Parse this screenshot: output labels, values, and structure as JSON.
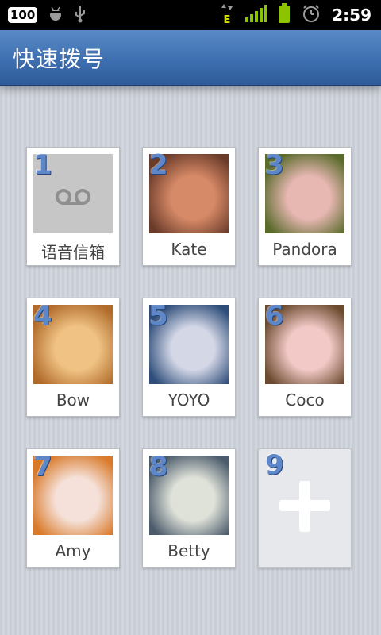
{
  "status_bar": {
    "battery_level_badge": "100",
    "network_type": "E",
    "time": "2:59"
  },
  "title": "快速拨号",
  "speed_dial": [
    {
      "number": "1",
      "name": "语音信箱",
      "kind": "voicemail"
    },
    {
      "number": "2",
      "name": "Kate",
      "kind": "contact",
      "colors": [
        "#6b3b2a",
        "#d78a67"
      ]
    },
    {
      "number": "3",
      "name": "Pandora",
      "kind": "contact",
      "colors": [
        "#5a6b2c",
        "#e7b7b2"
      ]
    },
    {
      "number": "4",
      "name": "Bow",
      "kind": "contact",
      "colors": [
        "#b06a2a",
        "#f0c384"
      ]
    },
    {
      "number": "5",
      "name": "YOYO",
      "kind": "contact",
      "colors": [
        "#2e4d7a",
        "#d3d7e6"
      ]
    },
    {
      "number": "6",
      "name": "Coco",
      "kind": "contact",
      "colors": [
        "#6b4a2f",
        "#f2c9c6"
      ]
    },
    {
      "number": "7",
      "name": "Amy",
      "kind": "contact",
      "colors": [
        "#d97a2a",
        "#f5e1d9"
      ]
    },
    {
      "number": "8",
      "name": "Betty",
      "kind": "contact",
      "colors": [
        "#4b5b6b",
        "#dfe2d9"
      ]
    },
    {
      "number": "9",
      "name": "",
      "kind": "add"
    }
  ]
}
